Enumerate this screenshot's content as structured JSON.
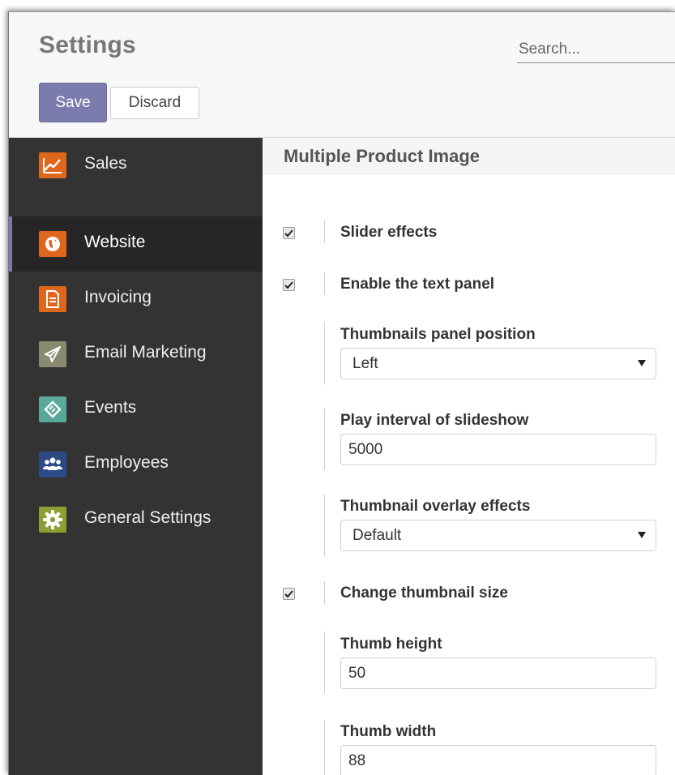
{
  "header": {
    "title": "Settings",
    "search_placeholder": "Search...",
    "save_label": "Save",
    "discard_label": "Discard"
  },
  "sidebar": {
    "items": [
      {
        "label": "Sales",
        "icon": "sales-chart-icon",
        "color": "#e0661c",
        "active": false
      },
      {
        "label": "Website",
        "icon": "globe-icon",
        "color": "#e0661c",
        "active": true
      },
      {
        "label": "Invoicing",
        "icon": "invoice-document-icon",
        "color": "#e0661c",
        "active": false
      },
      {
        "label": "Email Marketing",
        "icon": "paper-plane-icon",
        "color": "#8a8a70",
        "active": false
      },
      {
        "label": "Events",
        "icon": "ticket-icon",
        "color": "#5aa89a",
        "active": false
      },
      {
        "label": "Employees",
        "icon": "people-icon",
        "color": "#2b4a86",
        "active": false
      },
      {
        "label": "General Settings",
        "icon": "gear-icon",
        "color": "#8aa032",
        "active": false
      }
    ]
  },
  "main": {
    "section_title": "Multiple Product Image",
    "slider_effects": {
      "label": "Slider effects",
      "checked": true
    },
    "text_panel": {
      "label": "Enable the text panel",
      "checked": true
    },
    "thumb_position": {
      "label": "Thumbnails panel position",
      "value": "Left"
    },
    "play_interval": {
      "label": "Play interval of slideshow",
      "value": "5000"
    },
    "overlay_effects": {
      "label": "Thumbnail overlay effects",
      "value": "Default"
    },
    "thumb_size": {
      "label": "Change thumbnail size",
      "checked": true
    },
    "thumb_height": {
      "label": "Thumb height",
      "value": "50"
    },
    "thumb_width": {
      "label": "Thumb width",
      "value": "88"
    }
  },
  "colors": {
    "accent": "#7c7bad",
    "sidebar_bg": "#333333",
    "sidebar_active_bg": "#262626"
  }
}
